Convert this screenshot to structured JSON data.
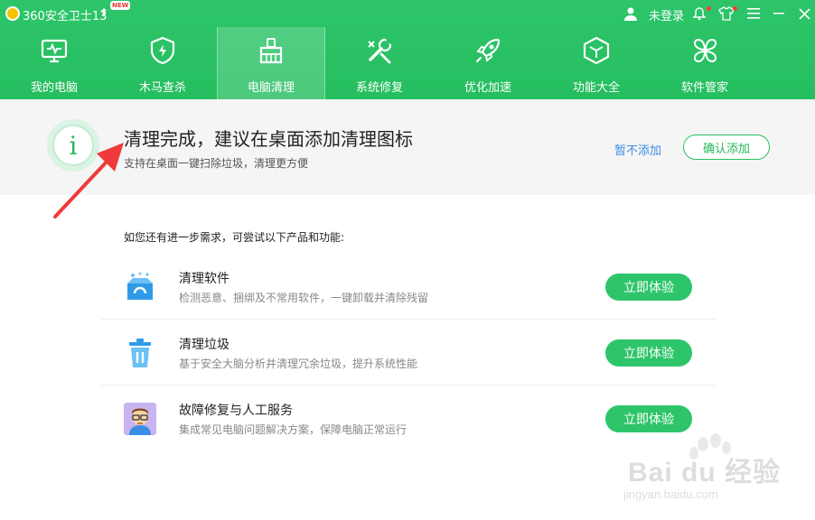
{
  "app": {
    "title": "360安全卫士13",
    "new_badge": "NEW"
  },
  "titlebar": {
    "login_label": "未登录"
  },
  "nav": {
    "items": [
      {
        "label": "我的电脑",
        "icon": "monitor-icon",
        "active": false
      },
      {
        "label": "木马查杀",
        "icon": "shield-icon",
        "active": false
      },
      {
        "label": "电脑清理",
        "icon": "broom-icon",
        "active": true
      },
      {
        "label": "系统修复",
        "icon": "wrench-icon",
        "active": false
      },
      {
        "label": "优化加速",
        "icon": "rocket-icon",
        "active": false
      },
      {
        "label": "功能大全",
        "icon": "cube-icon",
        "active": false
      },
      {
        "label": "软件管家",
        "icon": "clover-icon",
        "active": false
      }
    ]
  },
  "info": {
    "icon_glyph": "i",
    "title": "清理完成，建议在桌面添加清理图标",
    "subtitle": "支持在桌面一键扫除垃圾，清理更方便",
    "skip_label": "暂不添加",
    "confirm_label": "确认添加"
  },
  "suggest": {
    "hint": "如您还有进一步需求，可尝试以下产品和功能:",
    "rows": [
      {
        "title": "清理软件",
        "desc": "检测恶意、捆绑及不常用软件，一键卸载并清除残留",
        "button": "立即体验",
        "icon": "box-clean-icon"
      },
      {
        "title": "清理垃圾",
        "desc": "基于安全大脑分析并清理冗余垃圾，提升系统性能",
        "button": "立即体验",
        "icon": "trash-icon"
      },
      {
        "title": "故障修复与人工服务",
        "desc": "集成常见电脑问题解决方案，保障电脑正常运行",
        "button": "立即体验",
        "icon": "engineer-avatar-icon"
      }
    ]
  },
  "watermark": {
    "text1": "Bai du 经验",
    "text2": "jingyan.baidu.com"
  },
  "colors": {
    "brand_green": "#2ec56a",
    "link_blue": "#3a8ee6",
    "arrow_red": "#ee3a3a"
  }
}
